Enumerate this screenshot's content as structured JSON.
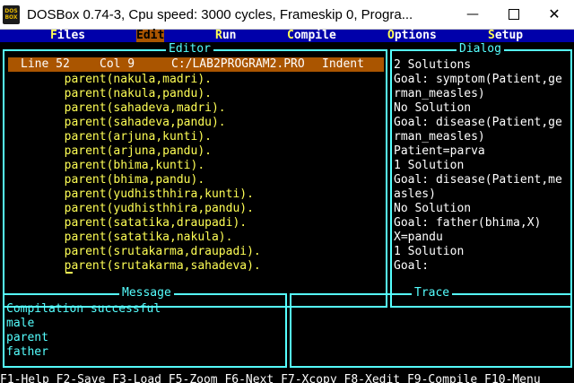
{
  "window": {
    "title": "DOSBox 0.74-3, Cpu speed:     3000 cycles, Frameskip  0, Progra...",
    "icon_text": "DOS BOX",
    "min_icon": "minimize-icon",
    "max_icon": "maximize-icon",
    "close_icon": "close-icon"
  },
  "menu": [
    {
      "hk": "F",
      "rest": "iles"
    },
    {
      "hk": "E",
      "rest": "dit"
    },
    {
      "hk": "R",
      "rest": "un"
    },
    {
      "hk": "C",
      "rest": "ompile"
    },
    {
      "hk": "O",
      "rest": "ptions"
    },
    {
      "hk": "S",
      "rest": "etup"
    }
  ],
  "editor": {
    "title": "Editor",
    "status": {
      "line": "Line 52",
      "col": "Col 9",
      "file": "C:/LAB2PROGRAM2.PRO",
      "mode": "Indent"
    },
    "lines": [
      "        parent(nakula,madri).",
      "        parent(nakula,pandu).",
      "        parent(sahadeva,madri).",
      "        parent(sahadeva,pandu).",
      "        parent(arjuna,kunti).",
      "        parent(arjuna,pandu).",
      "        parent(bhima,kunti).",
      "        parent(bhima,pandu).",
      "        parent(yudhisthhira,kunti).",
      "        parent(yudhisthhira,pandu).",
      "        parent(satatika,draupadi).",
      "        parent(satatika,nakula).",
      "        parent(srutakarma,draupadi).",
      "        parent(srutakarma,sahadeva)."
    ]
  },
  "dialog": {
    "title": "Dialog",
    "lines": [
      "2 Solutions",
      "Goal: symptom(Patient,ge",
      "rman_measles)",
      "No Solution",
      "Goal: disease(Patient,ge",
      "rman_measles)",
      "Patient=parva",
      "1 Solution",
      "Goal: disease(Patient,me",
      "asles)",
      "No Solution",
      "Goal: father(bhima,X)",
      "X=pandu",
      "1 Solution",
      "Goal:"
    ]
  },
  "message": {
    "title": "Message",
    "lines": [
      "Compilation successful",
      "male",
      "parent",
      "father"
    ]
  },
  "trace": {
    "title": "Trace"
  },
  "function_keys": "F1-Help F2-Save F3-Load F5-Zoom F6-Next F7-Xcopy F8-Xedit F9-Compile F10-Menu"
}
